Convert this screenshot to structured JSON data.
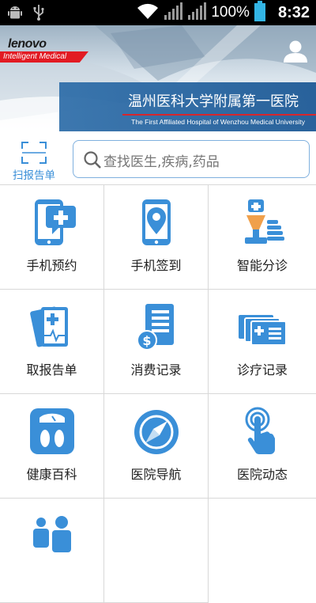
{
  "status_bar": {
    "battery_percent": "100%",
    "time": "8:32",
    "icons": [
      "android-icon",
      "usb-icon",
      "wifi-icon",
      "signal-icon",
      "signal-icon",
      "battery-icon"
    ]
  },
  "header": {
    "logo_text": "lenovo",
    "logo_tagline": "Intelligent Medical",
    "hospital_name_cn": "温州医科大学附属第一医院",
    "hospital_name_en": "The First Affiliated Hospital of Wenzhou Medical University"
  },
  "toolbar": {
    "scan_label": "扫报告单",
    "search_placeholder": "查找医生,疾病,药品"
  },
  "menu": [
    {
      "label": "手机预约",
      "icon": "phone-plus-icon"
    },
    {
      "label": "手机签到",
      "icon": "phone-location-icon"
    },
    {
      "label": "智能分诊",
      "icon": "triage-icon"
    },
    {
      "label": "取报告单",
      "icon": "report-icon"
    },
    {
      "label": "消费记录",
      "icon": "bill-icon"
    },
    {
      "label": "诊疗记录",
      "icon": "records-icon"
    },
    {
      "label": "健康百科",
      "icon": "scale-icon"
    },
    {
      "label": "医院导航",
      "icon": "compass-icon"
    },
    {
      "label": "医院动态",
      "icon": "touch-icon"
    },
    {
      "label": "",
      "icon": "people-icon"
    }
  ],
  "colors": {
    "accent": "#3a8fd8",
    "banner_blue": "#2c6ca8",
    "brand_red": "#e21b23"
  }
}
